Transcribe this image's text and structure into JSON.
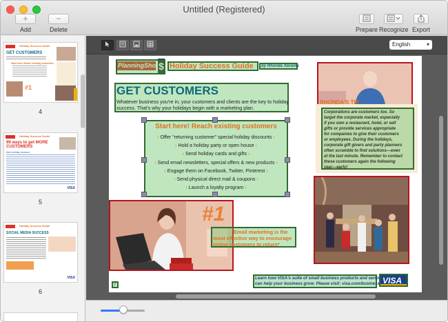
{
  "window": {
    "title": "Untitled (Registered)"
  },
  "toolbar": {
    "add_label": "Add",
    "delete_label": "Delete",
    "prepare_label": "Prepare",
    "recognize_label": "Recognize",
    "export_label": "Export"
  },
  "sidebar": {
    "pages": [
      {
        "number": "4",
        "header": "Holiday Success Guide",
        "heading": "GET CUSTOMERS",
        "sub": "Start here! Reach existing customers"
      },
      {
        "number": "5",
        "header": "Holiday Success Guide",
        "heading": "99 ways to get MORE CUSTOMERS",
        "sub": "this holiday season",
        "footer_logo": "VISA"
      },
      {
        "number": "6",
        "header": "Holiday Success Guide",
        "heading": "SOCIAL MEDIA SUCCESS",
        "footer_logo": "VISA"
      }
    ]
  },
  "language": {
    "selected": "English"
  },
  "document": {
    "logo_left": "PlanningShop",
    "header_title": "Holiday Success Guide",
    "header_byline": "by Rhonda Abrams",
    "heading": "GET CUSTOMERS",
    "intro": [
      "Whatever business you're in, your customers and clients are the key to holiday",
      "success. That's why your holidays begin with a marketing plan."
    ],
    "start_title": "Start here! Reach existing customers",
    "bullets": [
      "Offer “returning customer” special holiday discounts",
      "Hold a holiday party or open house",
      "Send holiday cards and gifts",
      "Send email newsletters, special offers & new products",
      "Engage them on Facebook, Twitter, Pinterest",
      "Send physical direct mail & coupons",
      "Launch a loyalty program"
    ],
    "tip_label": "RHONDA'S TIP",
    "tip_text": [
      "Corporations are customers too. So",
      "target the corporate market, especially",
      "if you own a restaurant, hotel, or sell",
      "gifts or provide services appropriate",
      "for companies to give their customers",
      "or employees. During the holidays,",
      "corporate gift givers and party planners",
      "often scramble to find solutions—even",
      "at the last minute. Remember to contact",
      "these customers again the following",
      "year—early!"
    ],
    "number_one": "#1",
    "stat_text": [
      "Email marketing is the",
      "most effective way to encourage",
      "online customers to return*"
    ],
    "footer_text": [
      "Learn how VISA's suite of small business products and services",
      "can help your business grow. Please visit: visa.com/business"
    ],
    "page_number": "7",
    "footer_logo": "VISA"
  },
  "colors": {
    "accent": "#3478f6",
    "green_box": "#2f6b2f",
    "red_box": "#b8141f",
    "doc_orange": "#e05a1c",
    "doc_teal": "#0f6a7a"
  }
}
